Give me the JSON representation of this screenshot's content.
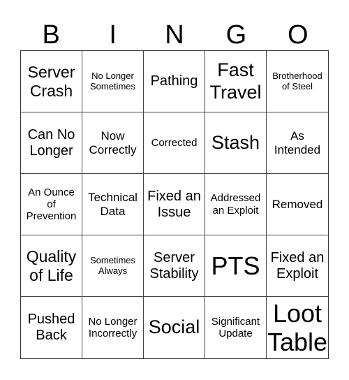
{
  "header": {
    "letters": [
      "B",
      "I",
      "N",
      "G",
      "O"
    ]
  },
  "grid": {
    "cells": [
      {
        "text": "Server Crash",
        "size": "s5"
      },
      {
        "text": "No Longer Sometimes",
        "size": "s1"
      },
      {
        "text": "Pathing",
        "size": "s4"
      },
      {
        "text": "Fast Travel",
        "size": "s6"
      },
      {
        "text": "Brotherhood of Steel",
        "size": "s1"
      },
      {
        "text": "Can No Longer",
        "size": "s4"
      },
      {
        "text": "Now Correctly",
        "size": "s3"
      },
      {
        "text": "Corrected",
        "size": "s2"
      },
      {
        "text": "Stash",
        "size": "s6"
      },
      {
        "text": "As Intended",
        "size": "s3"
      },
      {
        "text": "An Ounce of Prevention",
        "size": "s2"
      },
      {
        "text": "Technical Data",
        "size": "s3"
      },
      {
        "text": "Fixed an Issue",
        "size": "s4"
      },
      {
        "text": "Addressed an Exploit",
        "size": "s2"
      },
      {
        "text": "Removed",
        "size": "s3"
      },
      {
        "text": "Quality of Life",
        "size": "s5"
      },
      {
        "text": "Sometimes Always",
        "size": "s1"
      },
      {
        "text": "Server Stability",
        "size": "s4"
      },
      {
        "text": "PTS",
        "size": "s7"
      },
      {
        "text": "Fixed an Exploit",
        "size": "s4"
      },
      {
        "text": "Pushed Back",
        "size": "s4"
      },
      {
        "text": "No Longer Incorrectly",
        "size": "s2"
      },
      {
        "text": "Social",
        "size": "s6"
      },
      {
        "text": "Significant Update",
        "size": "s2"
      },
      {
        "text": "Loot Table",
        "size": "s7"
      }
    ]
  }
}
